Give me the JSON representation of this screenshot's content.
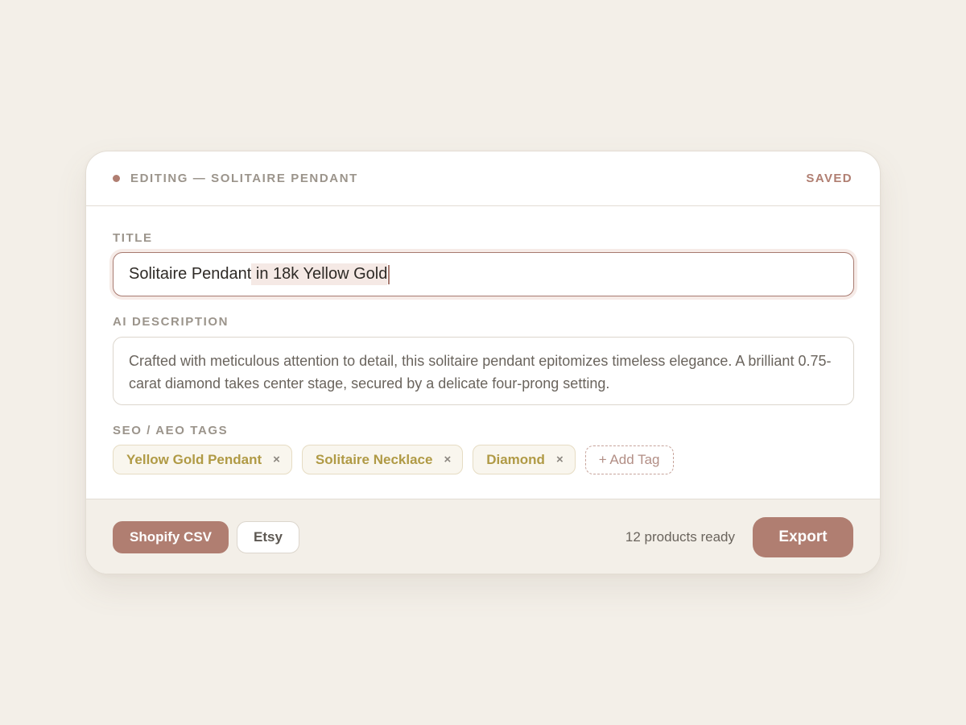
{
  "header": {
    "title": "EDITING — SOLITAIRE PENDANT",
    "status": "SAVED"
  },
  "title_field": {
    "label": "TITLE",
    "typed_text": "Solitaire Pendant",
    "suggested_text": " in 18k Yellow Gold"
  },
  "description_field": {
    "label": "AI DESCRIPTION",
    "value": "Crafted with meticulous attention to detail, this solitaire pendant epitomizes timeless elegance. A brilliant 0.75-carat diamond takes center stage, secured by a delicate four-prong setting."
  },
  "tags": {
    "label": "SEO / AEO TAGS",
    "items": [
      {
        "label": "Yellow Gold Pendant"
      },
      {
        "label": "Solitaire Necklace"
      },
      {
        "label": "Diamond"
      }
    ],
    "remove_glyph": "×",
    "add_label": "+ Add Tag"
  },
  "footer": {
    "formats": [
      {
        "label": "Shopify CSV",
        "active": true
      },
      {
        "label": "Etsy",
        "active": false
      }
    ],
    "ready_text": "12 products ready",
    "export_label": "Export"
  },
  "colors": {
    "accent": "#b07e71",
    "tag_text": "#b09a45",
    "background": "#f3efe8"
  }
}
